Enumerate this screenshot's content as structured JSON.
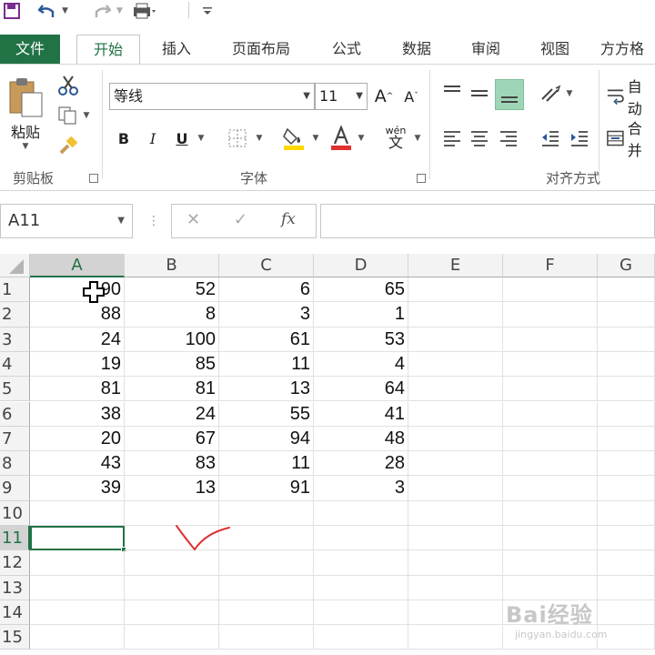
{
  "quick_access": {
    "save_icon": "save-icon",
    "undo_icon": "undo-icon",
    "redo_icon": "redo-icon",
    "print_icon": "print-preview-icon",
    "customize_icon": "customize-icon"
  },
  "tabs": [
    {
      "label": "文件"
    },
    {
      "label": "开始"
    },
    {
      "label": "插入"
    },
    {
      "label": "页面布局"
    },
    {
      "label": "公式"
    },
    {
      "label": "数据"
    },
    {
      "label": "审阅"
    },
    {
      "label": "视图"
    },
    {
      "label": "方方格"
    }
  ],
  "ribbon": {
    "clipboard": {
      "paste_label": "粘贴",
      "group_label": "剪贴板"
    },
    "font": {
      "font_name": "等线",
      "font_size": "11",
      "group_label": "字体",
      "bold": "B",
      "italic": "I",
      "underline": "U",
      "wen_top": "wén",
      "wen_bottom": "文",
      "grow": "A",
      "shrink": "A"
    },
    "alignment": {
      "group_label": "对齐方式",
      "wrap_label": "自动",
      "merge_label": "合并"
    }
  },
  "formula_bar": {
    "name_box": "A11",
    "cancel": "✕",
    "enter": "✓",
    "fx": "fx",
    "formula": ""
  },
  "sheet": {
    "columns": [
      "A",
      "B",
      "C",
      "D",
      "E",
      "F",
      "G"
    ],
    "rows": [
      "1",
      "2",
      "3",
      "4",
      "5",
      "6",
      "7",
      "8",
      "9",
      "10",
      "11",
      "12",
      "13",
      "14",
      "15"
    ],
    "cells": [
      [
        "90",
        "52",
        "6",
        "65"
      ],
      [
        "88",
        "8",
        "3",
        "1"
      ],
      [
        "24",
        "100",
        "61",
        "53"
      ],
      [
        "19",
        "85",
        "11",
        "4"
      ],
      [
        "81",
        "81",
        "13",
        "64"
      ],
      [
        "38",
        "24",
        "55",
        "41"
      ],
      [
        "20",
        "67",
        "94",
        "48"
      ],
      [
        "43",
        "83",
        "11",
        "28"
      ],
      [
        "39",
        "13",
        "91",
        "3"
      ]
    ],
    "active_cell": "A11",
    "annotation": "checkmark-annotation"
  },
  "watermark": {
    "text": "Bai经验",
    "url": "jingyan.baidu.com"
  },
  "colors": {
    "accent": "#217346",
    "annotation": "#e03030"
  }
}
